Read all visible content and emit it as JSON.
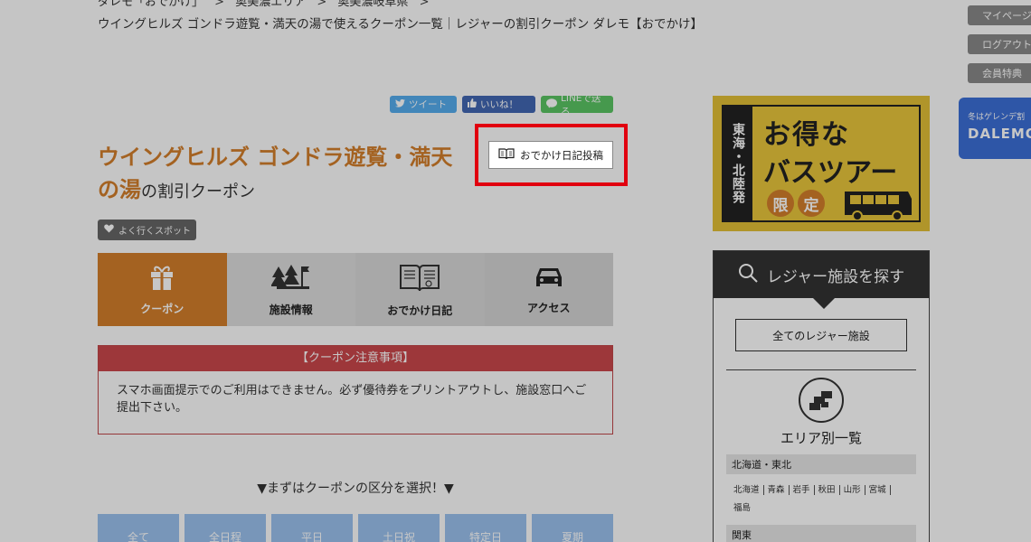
{
  "breadcrumb": {
    "items": [
      "ダレモ「おでかけ」",
      "奥美濃エリア",
      "奥美濃岐阜県"
    ],
    "separator": ">"
  },
  "page_heading": "ウイングヒルズ ゴンドラ遊覧・満天の湯で使えるクーポン一覧｜レジャーの割引クーポン ダレモ【おでかけ】",
  "share": {
    "tweet": "ツイート",
    "like": "いいね！",
    "line": "LINEで送る"
  },
  "title": {
    "name": "ウイングヒルズ ゴンドラ遊覧・満天の湯",
    "suffix": "の割引クーポン"
  },
  "diary_button": "おでかけ日記投稿",
  "favorite_badge": "よく行くスポット",
  "tabs": [
    {
      "label": "クーポン",
      "icon": "gift-icon",
      "active": true
    },
    {
      "label": "施設情報",
      "icon": "trees-flag-icon",
      "active": false
    },
    {
      "label": "おでかけ日記",
      "icon": "book-icon",
      "active": false
    },
    {
      "label": "アクセス",
      "icon": "car-icon",
      "active": false
    }
  ],
  "notice": {
    "heading": "【クーポン注意事項】",
    "body": "スマホ画面提示でのご利用はできません。必ず優待券をプリントアウトし、施設窓口へご提出下さい。"
  },
  "select_prompt": "▼まずはクーポンの区分を選択！▼",
  "categories": [
    "全て",
    "全日程",
    "平日",
    "土日祝",
    "特定日",
    "夏期"
  ],
  "bus_banner": {
    "side": "東海・北陸発",
    "line1": "お得な",
    "line2": "バスツアー",
    "limited": [
      "限",
      "定"
    ]
  },
  "leisure_panel": {
    "heading": "レジャー施設を探す",
    "all_button": "全てのレジャー施設",
    "area_title": "エリア別一覧",
    "regions": [
      {
        "name": "北海道・東北",
        "prefs": [
          "北海道",
          "青森",
          "岩手",
          "秋田",
          "山形",
          "宮城",
          "福島"
        ]
      },
      {
        "name": "関東",
        "prefs": []
      }
    ]
  },
  "utility": {
    "mypage": "マイページ",
    "logout": "ログアウト",
    "benefits": "会員特典"
  },
  "dalemo_banner": {
    "small": "冬はゲレンデ割",
    "big": "DALEMO"
  },
  "colors": {
    "accent_orange": "#d27e2b",
    "notice_red": "#c9474b",
    "highlight_red": "#e1000f",
    "category_blue": "#9ac1ee",
    "banner_yellow": "#e2bf37"
  }
}
